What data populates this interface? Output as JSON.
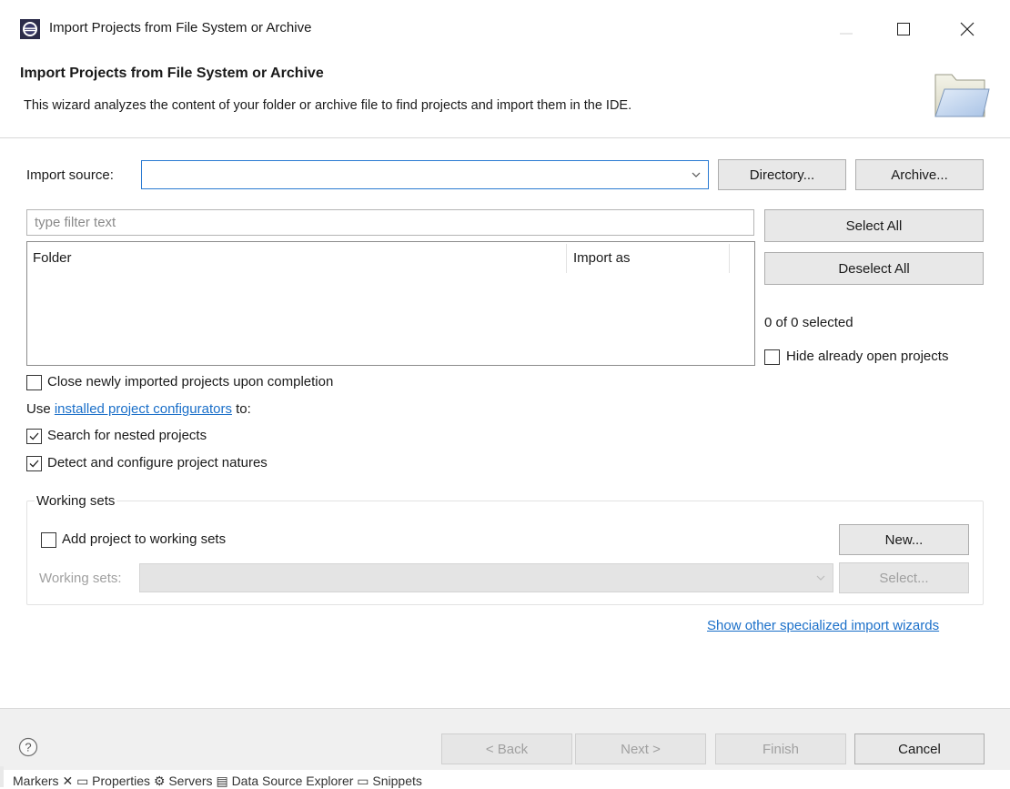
{
  "window": {
    "title": "Import Projects from File System or Archive"
  },
  "header": {
    "title": "Import Projects from File System or Archive",
    "description": "This wizard analyzes the content of your folder or archive file to find projects and import them in the IDE."
  },
  "import_source": {
    "label": "Import source:",
    "value": "",
    "directory_button": "Directory...",
    "archive_button": "Archive..."
  },
  "filter": {
    "placeholder": "type filter text"
  },
  "selection_buttons": {
    "select_all": "Select All",
    "deselect_all": "Deselect All",
    "count": "0 of 0 selected"
  },
  "table": {
    "columns": [
      "Folder",
      "Import as"
    ],
    "rows": []
  },
  "options": {
    "hide_open": {
      "label": "Hide already open projects",
      "checked": false
    },
    "close_newly": {
      "label": "Close newly imported projects upon completion",
      "checked": false
    },
    "use_prefix": "Use ",
    "use_link": "installed project configurators",
    "use_suffix": " to:",
    "nested": {
      "label": "Search for nested projects",
      "checked": true
    },
    "natures": {
      "label": "Detect and configure project natures",
      "checked": true
    }
  },
  "working_sets": {
    "legend": "Working sets",
    "add_label": "Add project to working sets",
    "add_checked": false,
    "new_button": "New...",
    "sets_label": "Working sets:",
    "select_button": "Select..."
  },
  "other_wizards_link": "Show other specialized import wizards",
  "footer": {
    "back": "< Back",
    "next": "Next >",
    "finish": "Finish",
    "cancel": "Cancel"
  },
  "background_strip": "Markers ✕ ▭ Properties ⚙ Servers ▤ Data Source Explorer ▭ Snippets",
  "colors": {
    "link": "#1a6fc9",
    "focus_border": "#2a7ad2",
    "footer_bg": "#f0f0f0"
  },
  "icons": [
    "eclipse-app-icon",
    "minimize-icon",
    "maximize-icon",
    "close-icon",
    "folder-open-icon",
    "chevron-down-icon",
    "checkmark-icon",
    "help-icon"
  ]
}
